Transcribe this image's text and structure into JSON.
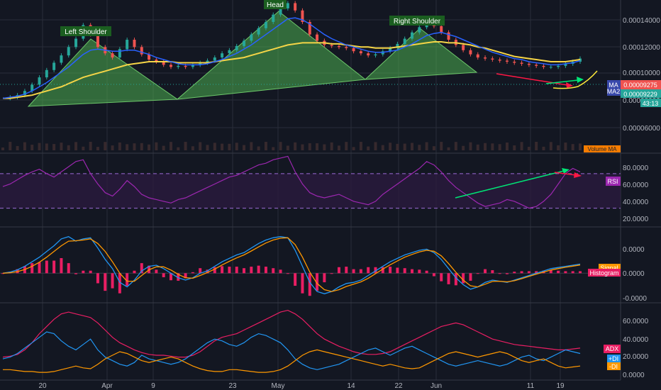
{
  "chart_data": {
    "type": "line",
    "pattern_labels": [
      "Left Shoulder",
      "Head",
      "Right Shoulder"
    ],
    "x_tick_labels": [
      "20",
      "Apr",
      "9",
      "23",
      "May",
      "14",
      "22",
      "Jun",
      "11",
      "19"
    ],
    "price_panel": {
      "y_tick_labels": [
        "0.00014000",
        "0.00012000",
        "0.00010000",
        "0.00008000",
        "0.00006000"
      ],
      "ylim": [
        5.2e-06,
        0.000149
      ],
      "last_price_label": "0.00009275",
      "ma_price_label": "0.00009229",
      "countdown_label": "43:13",
      "ma_badge": "MA",
      "ma_badge_sub": "MA2",
      "volume_ma_label": "Volume MA",
      "price": [
        5.5e-05,
        5.6e-05,
        5.8e-05,
        6.2e-05,
        6.8e-05,
        7.5e-05,
        8.2e-05,
        8.9e-05,
        9.6e-05,
        0.000104,
        0.000112,
        0.000125,
        0.000116,
        0.000104,
        9.8e-05,
        9.4e-05,
        0.000102,
        0.000111,
        0.000104,
        9.7e-05,
        9.2e-05,
        9e-05,
        8.7e-05,
        8.5e-05,
        8.6e-05,
        8.5e-05,
        8.7e-05,
        8.9e-05,
        9.1e-05,
        9.4e-05,
        9.8e-05,
        0.000101,
        0.000105,
        0.00011,
        0.000116,
        0.000122,
        0.000128,
        0.000135,
        0.000141,
        0.000146,
        0.000139,
        0.000128,
        0.000116,
        0.00011,
        0.000106,
        0.000105,
        0.000104,
        0.000103,
        0.0001,
        9.8e-05,
        9.6e-05,
        9.7e-05,
        0.0001,
        0.000103,
        0.000107,
        0.000112,
        0.000118,
        0.000123,
        0.000127,
        0.000124,
        0.000118,
        0.000111,
        0.000106,
        0.000101,
        9.7e-05,
        9.4e-05,
        9.3e-05,
        9.2e-05,
        9.1e-05,
        9e-05,
        8.9e-05,
        8.8e-05,
        8.7e-05,
        8.6e-05,
        8.5e-05,
        8.5e-05,
        8.6e-05,
        8.8e-05,
        9e-05,
        9.3e-05
      ],
      "ma_yellow": [
        5.5e-05,
        5.5e-05,
        5.6e-05,
        5.7e-05,
        5.8e-05,
        6e-05,
        6.2e-05,
        6.4e-05,
        6.6e-05,
        6.9e-05,
        7.2e-05,
        7.5e-05,
        7.7e-05,
        7.9e-05,
        8.1e-05,
        8.3e-05,
        8.5e-05,
        8.7e-05,
        8.8e-05,
        8.9e-05,
        9e-05,
        9e-05,
        9e-05,
        9e-05,
        8.9e-05,
        8.9e-05,
        8.9e-05,
        8.9e-05,
        8.9e-05,
        9e-05,
        9.1e-05,
        9.2e-05,
        9.3e-05,
        9.4e-05,
        9.6e-05,
        9.8e-05,
        0.0001,
        0.000102,
        0.000104,
        0.000106,
        0.000107,
        0.000108,
        0.000108,
        0.000108,
        0.000108,
        0.000107,
        0.000107,
        0.000106,
        0.000105,
        0.000104,
        0.000104,
        0.000103,
        0.000103,
        0.000103,
        0.000104,
        0.000105,
        0.000106,
        0.000107,
        0.000108,
        0.000109,
        0.000109,
        0.000108,
        0.000108,
        0.000107,
        0.000106,
        0.000104,
        0.000103,
        0.000101,
        9.9e-05,
        9.7e-05,
        9.5e-05,
        9.4e-05,
        9.3e-05,
        9.2e-05,
        9.1e-05,
        9e-05,
        9e-05,
        9e-05,
        9.1e-05,
        9.2e-05
      ],
      "ma_blue": [
        5.5e-05,
        5.6e-05,
        5.7e-05,
        5.9e-05,
        6.2e-05,
        6.6e-05,
        7e-05,
        7.5e-05,
        8e-05,
        8.5e-05,
        9.1e-05,
        9.7e-05,
        0.000101,
        0.000102,
        0.000101,
        0.0001,
        0.0001,
        0.000101,
        0.000101,
        9.9e-05,
        9.7e-05,
        9.4e-05,
        9.2e-05,
        9e-05,
        8.8e-05,
        8.7e-05,
        8.7e-05,
        8.7e-05,
        8.8e-05,
        9e-05,
        9.2e-05,
        9.5e-05,
        9.8e-05,
        0.000102,
        0.000106,
        0.000111,
        0.000116,
        0.000121,
        0.000126,
        0.000131,
        0.000132,
        0.00013,
        0.000126,
        0.000121,
        0.000116,
        0.000112,
        0.000109,
        0.000106,
        0.000104,
        0.000102,
        0.0001,
        9.9e-05,
        9.9e-05,
        0.0001,
        0.000101,
        0.000104,
        0.000107,
        0.000111,
        0.000115,
        0.000117,
        0.000118,
        0.000116,
        0.000114,
        0.000111,
        0.000108,
        0.000105,
        0.000102,
        9.9e-05,
        9.7e-05,
        9.5e-05,
        9.3e-05,
        9.2e-05,
        9e-05,
        8.9e-05,
        8.8e-05,
        8.7e-05,
        8.7e-05,
        8.8e-05,
        8.9e-05,
        9.1e-05
      ]
    },
    "rsi_panel": {
      "title": "RSI",
      "y_tick_labels": [
        "80.0000",
        "60.0000",
        "40.0000",
        "20.0000"
      ],
      "ylim": [
        10,
        92
      ],
      "bands": [
        30,
        70
      ],
      "values": [
        55,
        58,
        63,
        68,
        72,
        75,
        70,
        66,
        72,
        78,
        84,
        86,
        70,
        58,
        48,
        44,
        52,
        62,
        55,
        46,
        42,
        40,
        38,
        36,
        40,
        42,
        46,
        50,
        54,
        58,
        62,
        66,
        68,
        72,
        76,
        80,
        82,
        86,
        88,
        90,
        72,
        58,
        48,
        44,
        42,
        44,
        46,
        42,
        38,
        36,
        34,
        38,
        46,
        52,
        58,
        64,
        70,
        76,
        84,
        80,
        72,
        62,
        54,
        48,
        42,
        36,
        32,
        34,
        36,
        40,
        38,
        34,
        30,
        32,
        38,
        46,
        58,
        70,
        76,
        72
      ]
    },
    "macd_panel": {
      "y_tick_labels": [
        "0.0000",
        "0.0000",
        "-0.0000"
      ],
      "ylim": [
        -1.2,
        1.9
      ],
      "signal_label": "Signal",
      "histogram_label": "Histogram",
      "macd": [
        0,
        0.05,
        0.15,
        0.3,
        0.5,
        0.7,
        0.95,
        1.2,
        1.5,
        1.6,
        1.4,
        1.5,
        1.55,
        1.1,
        0.6,
        0.2,
        -0.4,
        -0.6,
        -0.3,
        0.1,
        0.3,
        0.35,
        0.2,
        0.0,
        -0.2,
        -0.3,
        -0.2,
        0,
        0.1,
        0.3,
        0.5,
        0.65,
        0.8,
        0.9,
        1.1,
        1.3,
        1.45,
        1.55,
        1.6,
        1.55,
        1.0,
        0.3,
        -0.4,
        -0.8,
        -0.9,
        -0.8,
        -0.6,
        -0.45,
        -0.4,
        -0.3,
        -0.1,
        0.1,
        0.3,
        0.5,
        0.65,
        0.8,
        0.9,
        1.0,
        1.05,
        0.9,
        0.6,
        0.2,
        -0.2,
        -0.5,
        -0.7,
        -0.6,
        -0.4,
        -0.3,
        -0.35,
        -0.4,
        -0.3,
        -0.2,
        -0.1,
        0.0,
        0.1,
        0.2,
        0.25,
        0.3,
        0.35,
        0.4
      ],
      "signal": [
        0,
        0.02,
        0.07,
        0.16,
        0.3,
        0.48,
        0.7,
        0.95,
        1.2,
        1.4,
        1.42,
        1.45,
        1.5,
        1.3,
        0.95,
        0.5,
        0.0,
        -0.35,
        -0.35,
        -0.1,
        0.15,
        0.28,
        0.28,
        0.14,
        -0.05,
        -0.2,
        -0.22,
        -0.1,
        0.03,
        0.18,
        0.36,
        0.52,
        0.67,
        0.8,
        0.97,
        1.15,
        1.32,
        1.45,
        1.53,
        1.55,
        1.25,
        0.7,
        0.05,
        -0.45,
        -0.72,
        -0.8,
        -0.72,
        -0.58,
        -0.48,
        -0.38,
        -0.22,
        -0.02,
        0.18,
        0.37,
        0.54,
        0.7,
        0.82,
        0.93,
        1.0,
        0.96,
        0.76,
        0.42,
        0.04,
        -0.3,
        -0.55,
        -0.6,
        -0.48,
        -0.36,
        -0.35,
        -0.38,
        -0.33,
        -0.24,
        -0.14,
        -0.04,
        0.05,
        0.14,
        0.2,
        0.26,
        0.31,
        0.36
      ]
    },
    "adx_panel": {
      "y_tick_labels": [
        "60.0000",
        "40.0000",
        "20.0000",
        "0.0000"
      ],
      "ylim": [
        -2,
        80
      ],
      "adx_label": "ADX",
      "plus_di_label": "+DI",
      "minus_di_label": "-DI",
      "adx": [
        22,
        23,
        25,
        30,
        38,
        48,
        56,
        64,
        70,
        72,
        70,
        68,
        66,
        60,
        52,
        44,
        38,
        34,
        30,
        27,
        25,
        24,
        24,
        23,
        22,
        22,
        24,
        28,
        34,
        40,
        44,
        46,
        48,
        52,
        56,
        60,
        64,
        68,
        72,
        74,
        70,
        64,
        56,
        48,
        42,
        38,
        34,
        31,
        28,
        26,
        25,
        25,
        26,
        28,
        32,
        36,
        40,
        44,
        48,
        52,
        56,
        58,
        60,
        58,
        54,
        50,
        46,
        42,
        40,
        38,
        36,
        35,
        34,
        33,
        32,
        31,
        30,
        30,
        31,
        32
      ],
      "plus_di": [
        20,
        22,
        26,
        32,
        38,
        44,
        50,
        48,
        40,
        34,
        30,
        36,
        42,
        30,
        22,
        18,
        14,
        12,
        16,
        24,
        20,
        18,
        16,
        14,
        16,
        20,
        26,
        32,
        38,
        42,
        40,
        36,
        34,
        38,
        44,
        48,
        46,
        42,
        38,
        30,
        20,
        14,
        10,
        8,
        10,
        12,
        14,
        18,
        22,
        26,
        30,
        32,
        28,
        24,
        28,
        32,
        34,
        30,
        26,
        22,
        18,
        14,
        12,
        14,
        16,
        18,
        16,
        14,
        12,
        14,
        18,
        22,
        24,
        20,
        18,
        22,
        26,
        30,
        28,
        26
      ],
      "minus_di": [
        8,
        8,
        7,
        6,
        6,
        5,
        5,
        6,
        8,
        10,
        12,
        10,
        9,
        14,
        20,
        24,
        28,
        26,
        22,
        18,
        16,
        18,
        20,
        22,
        20,
        16,
        12,
        9,
        7,
        6,
        6,
        8,
        8,
        7,
        6,
        5,
        5,
        6,
        8,
        12,
        18,
        24,
        28,
        30,
        28,
        26,
        24,
        22,
        20,
        18,
        16,
        14,
        12,
        14,
        12,
        10,
        9,
        10,
        14,
        18,
        22,
        26,
        28,
        26,
        24,
        22,
        24,
        26,
        28,
        26,
        22,
        18,
        16,
        18,
        20,
        16,
        12,
        10,
        11,
        12
      ]
    },
    "colors": {
      "background": "#131722",
      "grid": "#2a2e39",
      "up_candle": "#26a69a",
      "down_candle": "#ef5350",
      "ma_yellow": "#f5d547",
      "ma_blue": "#2962ff",
      "pattern_fill": "#4caf50",
      "rsi_line": "#9c27b0",
      "rsi_band": "#2a1a3e",
      "macd_line": "#2196f3",
      "signal_line": "#ff9800",
      "histogram": "#e91e63",
      "adx_line": "#e91e63",
      "plus_di_line": "#2196f3",
      "minus_di_line": "#ff9800",
      "arrow_green": "#00e676",
      "arrow_red": "#ff1744",
      "forecast_yellow": "#ffeb3b"
    }
  }
}
